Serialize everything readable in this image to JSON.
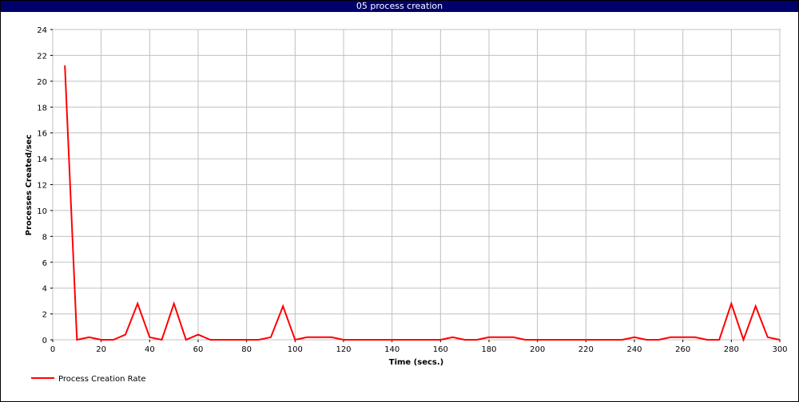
{
  "window": {
    "title": "05 process creation"
  },
  "chart_data": {
    "type": "line",
    "title": "05 process creation",
    "xlabel": "Time (secs.)",
    "ylabel": "Processes Created/sec",
    "xlim": [
      0,
      300
    ],
    "ylim": [
      0,
      24
    ],
    "xticks": [
      0,
      20,
      40,
      60,
      80,
      100,
      120,
      140,
      160,
      180,
      200,
      220,
      240,
      260,
      280,
      300
    ],
    "yticks": [
      0,
      2,
      4,
      6,
      8,
      10,
      12,
      14,
      16,
      18,
      20,
      22,
      24
    ],
    "grid": true,
    "legend_position": "bottom-left",
    "series": [
      {
        "name": "Process Creation Rate",
        "color": "#ff0000",
        "x": [
          5,
          10,
          15,
          20,
          25,
          30,
          35,
          40,
          45,
          50,
          55,
          60,
          65,
          70,
          75,
          80,
          85,
          90,
          95,
          100,
          105,
          110,
          115,
          120,
          125,
          130,
          135,
          140,
          145,
          150,
          155,
          160,
          165,
          170,
          175,
          180,
          185,
          190,
          195,
          200,
          205,
          210,
          215,
          220,
          225,
          230,
          235,
          240,
          245,
          250,
          255,
          260,
          265,
          270,
          275,
          280,
          285,
          290,
          295,
          300
        ],
        "y": [
          21.2,
          0,
          0.2,
          0,
          0,
          0.4,
          2.8,
          0.2,
          0,
          2.8,
          0,
          0.4,
          0,
          0,
          0,
          0,
          0,
          0.2,
          2.6,
          0,
          0.2,
          0.2,
          0.2,
          0,
          0,
          0,
          0,
          0,
          0,
          0,
          0,
          0,
          0.2,
          0,
          0,
          0.2,
          0.2,
          0.2,
          0,
          0,
          0,
          0,
          0,
          0,
          0,
          0,
          0,
          0.2,
          0,
          0,
          0.2,
          0.2,
          0.2,
          0,
          0,
          2.8,
          0,
          2.6,
          0.2,
          0
        ]
      }
    ]
  }
}
